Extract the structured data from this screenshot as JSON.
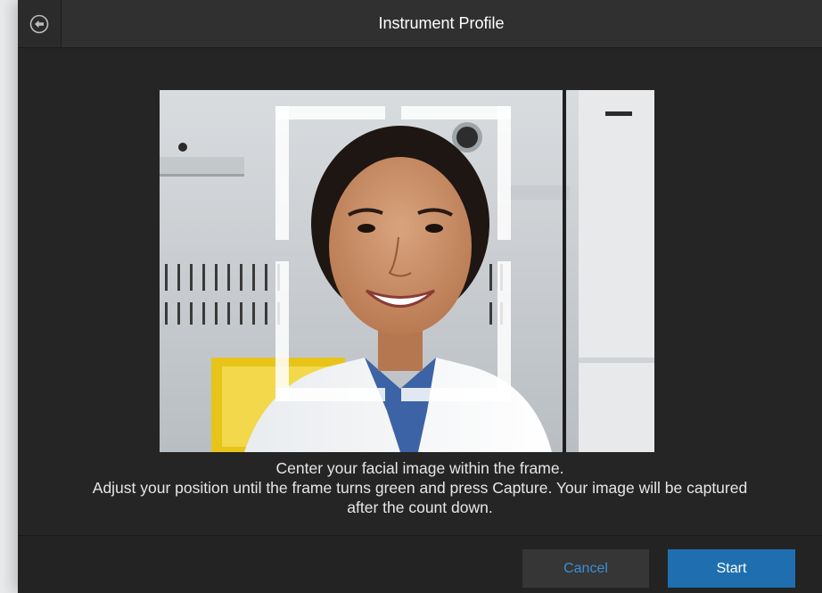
{
  "header": {
    "title": "Instrument Profile",
    "back_icon": "arrow-left-circle-icon"
  },
  "camera_preview": {
    "content": "photo-placeholder",
    "frame_color": "#ffffff"
  },
  "instructions": {
    "line1": "Center your facial image within the frame.",
    "line2": "Adjust your position until the frame turns green and press Capture. Your image will be captured",
    "line3": "after the count down."
  },
  "footer": {
    "cancel_label": "Cancel",
    "start_label": "Start"
  },
  "colors": {
    "accent": "#1f6fb0",
    "link": "#3a8fd6",
    "background": "#252525"
  }
}
